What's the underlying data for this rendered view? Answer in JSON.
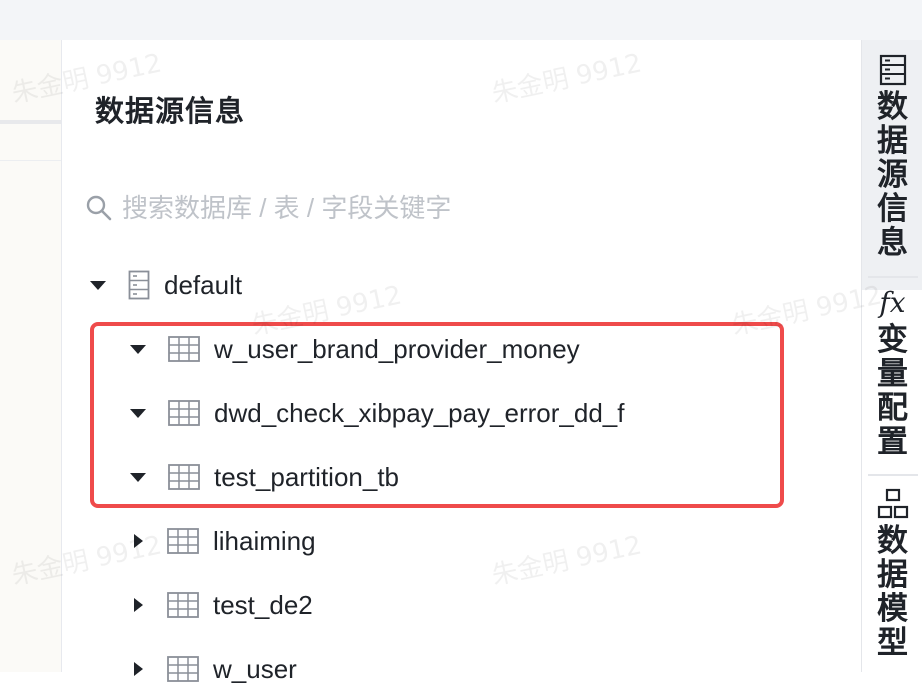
{
  "panel": {
    "title": "数据源信息",
    "search_placeholder": "搜索数据库 / 表 / 字段关键字"
  },
  "tree": {
    "database": {
      "name": "default",
      "expanded": true,
      "icon": "database-icon"
    },
    "tables": [
      {
        "name": "w_user_brand_provider_money",
        "expanded": true
      },
      {
        "name": "dwd_check_xibpay_pay_error_dd_f",
        "expanded": true
      },
      {
        "name": "test_partition_tb",
        "expanded": true
      },
      {
        "name": "lihaiming",
        "expanded": false
      },
      {
        "name": "test_de2",
        "expanded": false
      },
      {
        "name": "w_user",
        "expanded": false
      }
    ]
  },
  "right_sidebar": {
    "tabs": [
      {
        "label": "数据源信息",
        "icon": "database-icon",
        "active": true
      },
      {
        "label": "变量配置",
        "icon_text": "fx",
        "active": false
      },
      {
        "label": "数据模型",
        "icon": "model-icon",
        "active": false
      }
    ]
  },
  "watermark": "朱金明 9912",
  "colors": {
    "highlight": "#ef4b4b",
    "text": "#1f2329",
    "placeholder": "#bfc3c9"
  }
}
